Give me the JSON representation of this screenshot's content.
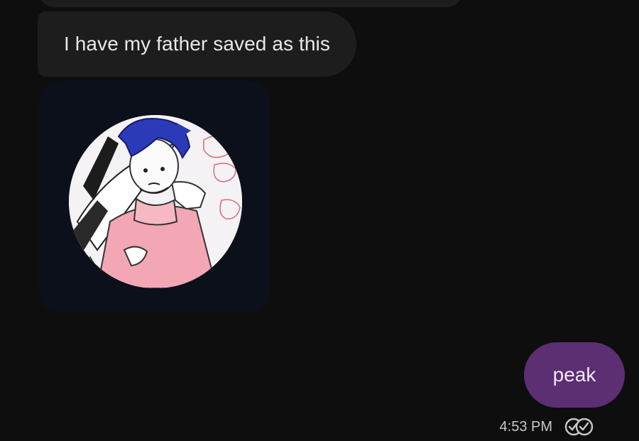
{
  "conversation": {
    "messages": [
      {
        "direction": "incoming",
        "type": "text",
        "text": "I have my father saved as this"
      },
      {
        "direction": "incoming",
        "type": "image",
        "image_description_icon": "contact-avatar-drawing-icon"
      },
      {
        "direction": "outgoing",
        "type": "text",
        "text": "peak",
        "timestamp": "4:53 PM",
        "status_icon": "read-receipt-icon"
      }
    ]
  },
  "colors": {
    "background": "#0e0e0f",
    "incoming_bubble": "#1c1d1c",
    "outgoing_bubble": "#5c2e72",
    "image_card": "#0c101a",
    "incoming_text": "#e8e8e6",
    "outgoing_text": "#f1e9f6",
    "timestamp": "#c9c9c9"
  }
}
